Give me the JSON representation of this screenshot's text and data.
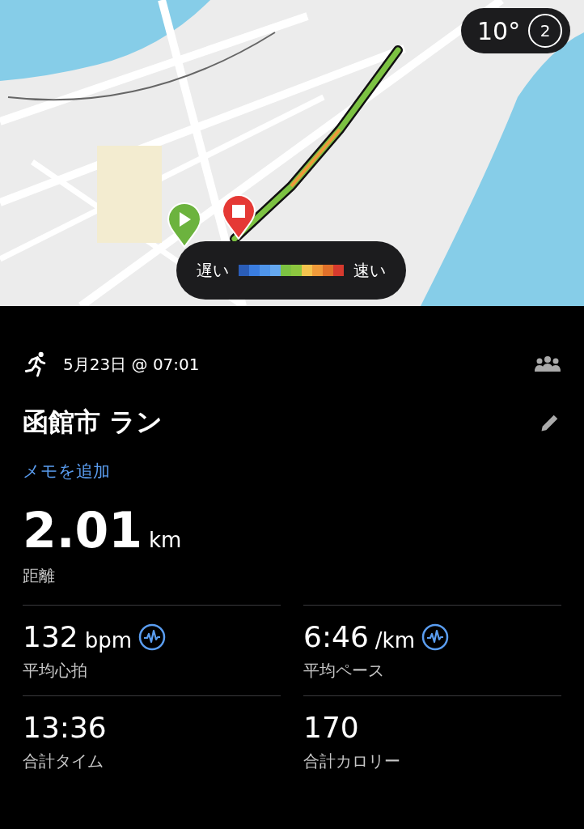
{
  "map": {
    "weather": {
      "temperature": "10°",
      "compass": "2"
    },
    "legend": {
      "slow": "遅い",
      "fast": "速い",
      "scale": [
        {
          "color": "#2a5db8"
        },
        {
          "color": "#3a7de0"
        },
        {
          "color": "#4f95ea"
        },
        {
          "color": "#65a8ef"
        },
        {
          "color": "#7cc242"
        },
        {
          "color": "#8cc63f"
        },
        {
          "color": "#f3c34e"
        },
        {
          "color": "#ef9a3a"
        },
        {
          "color": "#e0702a"
        },
        {
          "color": "#d63a2e"
        }
      ]
    }
  },
  "activity": {
    "date": "5月23日 @ 07:01",
    "title": "函館市 ラン",
    "add_note": "メモを追加"
  },
  "distance": {
    "value": "2.01",
    "unit": "km",
    "label": "距離"
  },
  "stats": [
    {
      "value": "132",
      "unit": "bpm",
      "label": "平均心拍",
      "chart_icon": true
    },
    {
      "value": "6:46",
      "unit": "/km",
      "label": "平均ペース",
      "chart_icon": true
    },
    {
      "value": "13:36",
      "label": "合計タイム",
      "chart_icon": false
    },
    {
      "value": "170",
      "label": "合計カロリー",
      "chart_icon": false
    }
  ]
}
